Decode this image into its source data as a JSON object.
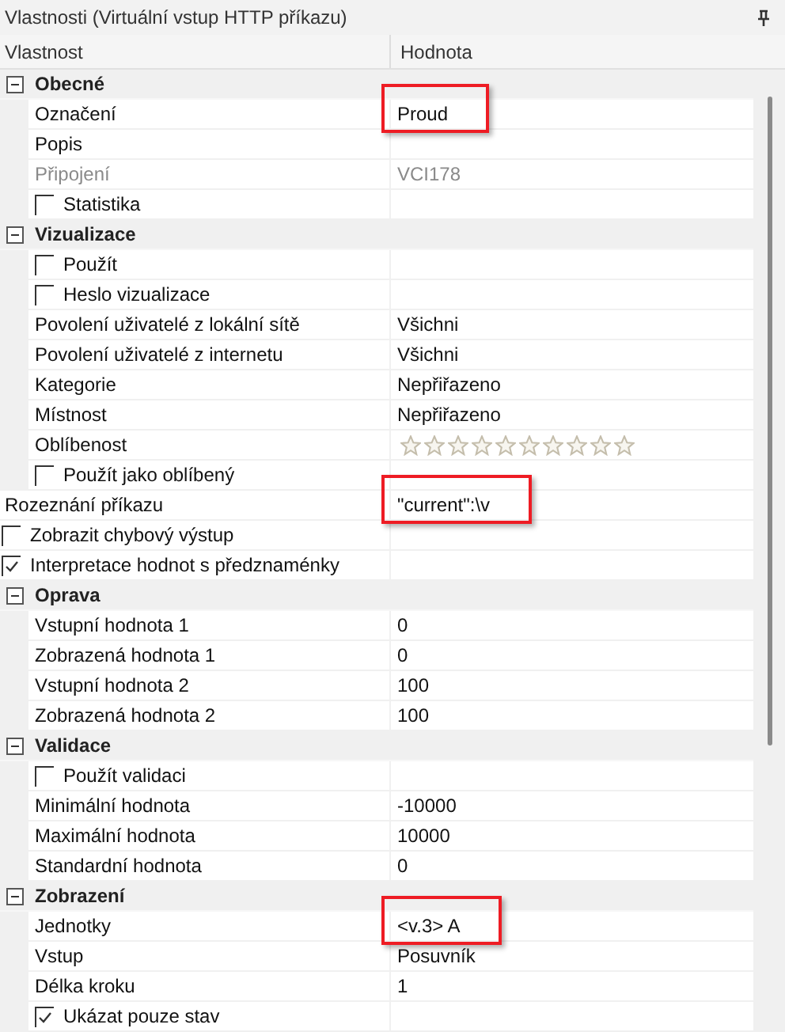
{
  "panel": {
    "title": "Vlastnosti (Virtuální vstup HTTP příkazu)"
  },
  "columns": [
    "Vlastnost",
    "Hodnota"
  ],
  "rows": [
    {
      "kind": "section",
      "label": "Obecné",
      "expanded": true,
      "children": [
        {
          "kind": "property",
          "label": "Označení",
          "value": "Proud",
          "disabled": false,
          "highlighted": true
        },
        {
          "kind": "property",
          "label": "Popis",
          "disabled": false,
          "highlighted": false
        },
        {
          "kind": "property",
          "label": "Připojení",
          "value": "VCI178",
          "disabled": true,
          "highlighted": false
        },
        {
          "kind": "checkbox",
          "label": "Statistika",
          "checked": false
        }
      ]
    },
    {
      "kind": "section",
      "label": "Vizualizace",
      "expanded": true,
      "children": [
        {
          "kind": "checkbox",
          "label": "Použít",
          "checked": false
        },
        {
          "kind": "checkbox",
          "label": "Heslo vizualizace",
          "checked": false
        },
        {
          "kind": "property",
          "label": "Povolení uživatelé z lokální sítě",
          "value": "Všichni",
          "disabled": false,
          "highlighted": false
        },
        {
          "kind": "property",
          "label": "Povolení uživatelé z internetu",
          "value": "Všichni",
          "disabled": false,
          "highlighted": false
        },
        {
          "kind": "property",
          "label": "Kategorie",
          "value": "Nepřiřazeno",
          "disabled": false,
          "highlighted": false
        },
        {
          "kind": "property",
          "label": "Místnost",
          "value": "Nepřiřazeno",
          "disabled": false,
          "highlighted": false
        },
        {
          "kind": "rating",
          "label": "Oblíbenost",
          "stars": 0
        },
        {
          "kind": "checkbox",
          "label": "Použít jako oblíbený",
          "checked": false
        }
      ]
    },
    {
      "kind": "property",
      "label": "Rozeznání příkazu",
      "value": "\"current\":\\v",
      "disabled": false,
      "highlighted": true
    },
    {
      "kind": "checkbox",
      "label": "Zobrazit chybový výstup",
      "checked": false
    },
    {
      "kind": "checkbox",
      "label": "Interpretace hodnot s předznaménky",
      "checked": true
    },
    {
      "kind": "section",
      "label": "Oprava",
      "expanded": true,
      "children": [
        {
          "kind": "property",
          "label": "Vstupní hodnota 1",
          "value": "0",
          "disabled": false,
          "highlighted": false
        },
        {
          "kind": "property",
          "label": "Zobrazená hodnota 1",
          "value": "0",
          "disabled": false,
          "highlighted": false
        },
        {
          "kind": "property",
          "label": "Vstupní hodnota 2",
          "value": "100",
          "disabled": false,
          "highlighted": false
        },
        {
          "kind": "property",
          "label": "Zobrazená hodnota 2",
          "value": "100",
          "disabled": false,
          "highlighted": false
        }
      ]
    },
    {
      "kind": "section",
      "label": "Validace",
      "expanded": true,
      "children": [
        {
          "kind": "checkbox",
          "label": "Použít validaci",
          "checked": false
        },
        {
          "kind": "property",
          "label": "Minimální hodnota",
          "value": "-10000",
          "disabled": false,
          "highlighted": false
        },
        {
          "kind": "property",
          "label": "Maximální hodnota",
          "value": "10000",
          "disabled": false,
          "highlighted": false
        },
        {
          "kind": "property",
          "label": "Standardní hodnota",
          "value": "0",
          "disabled": false,
          "highlighted": false
        }
      ]
    },
    {
      "kind": "section",
      "label": "Zobrazení",
      "expanded": true,
      "children": [
        {
          "kind": "property",
          "label": "Jednotky",
          "value": "<v.3> A",
          "disabled": false,
          "highlighted": true
        },
        {
          "kind": "property",
          "label": "Vstup",
          "value": "Posuvník",
          "disabled": false,
          "highlighted": false
        },
        {
          "kind": "property",
          "label": "Délka kroku",
          "value": "1",
          "disabled": false,
          "highlighted": false
        },
        {
          "kind": "checkbox",
          "label": "Ukázat pouze stav",
          "checked": true
        }
      ]
    }
  ]
}
